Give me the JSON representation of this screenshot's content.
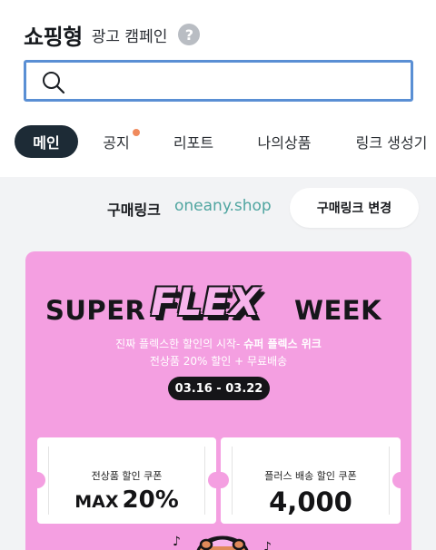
{
  "header": {
    "title": "쇼핑형",
    "subtitle": "광고 캠페인",
    "help_icon": "question-circle-icon"
  },
  "search": {
    "placeholder": "",
    "value": "",
    "icon": "search-icon",
    "border_color": "#5a8fd4"
  },
  "tabs": [
    {
      "label": "메인",
      "active": true
    },
    {
      "label": "공지",
      "active": false,
      "notification_dot": true
    },
    {
      "label": "리포트",
      "active": false
    },
    {
      "label": "나의상품",
      "active": false
    },
    {
      "label": "링크 생성기",
      "active": false
    }
  ],
  "purchase_link": {
    "label": "구매링크",
    "url": "oneany.shop",
    "change_button": "구매링크 변경"
  },
  "banner": {
    "headline_left": "SUPER",
    "headline_mid": "FLEX",
    "headline_right": "WEEK",
    "tagline_prefix": "진짜 플렉스한 할인의 시작- ",
    "tagline_bold": "슈퍼 플렉스 위크",
    "tagline2": "전상품 20% 할인 + 무료배송",
    "date_range": "03.16 - 03.22",
    "background": "#f49fe1",
    "coupons": [
      {
        "name": "전상품 할인 쿠폰",
        "prefix": "MAX",
        "value": "20%"
      },
      {
        "name": "플러스 배송 할인 쿠폰",
        "value": "4,000"
      }
    ]
  },
  "colors": {
    "active_tab": "#1d2b36",
    "link_url": "#4fa5a0",
    "notice_dot": "#f08a5d"
  }
}
